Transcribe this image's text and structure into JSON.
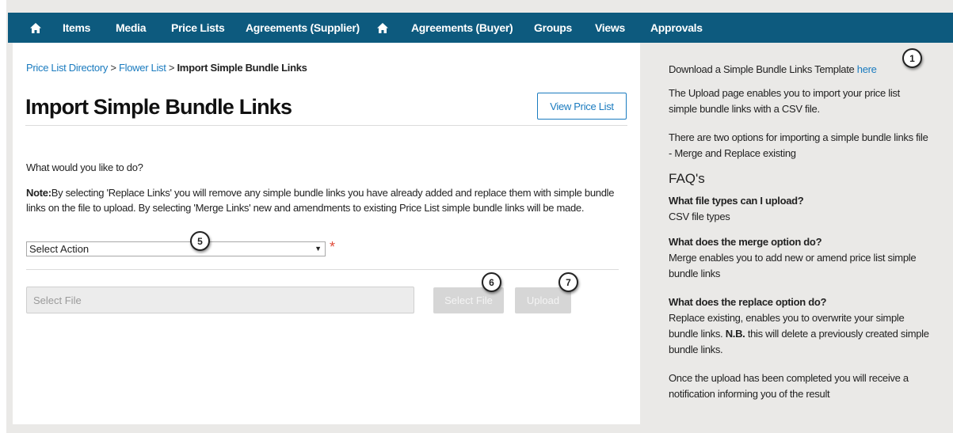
{
  "nav": {
    "items": [
      "Items",
      "Media",
      "Price Lists",
      "Agreements (Supplier)",
      "Agreements (Buyer)",
      "Groups",
      "Views",
      "Approvals"
    ],
    "home_icon": "home-icon"
  },
  "breadcrumb": {
    "items": [
      "Price List Directory",
      "Flower List"
    ],
    "separator": ">",
    "current": "Import Simple Bundle Links"
  },
  "page": {
    "title": "Import Simple Bundle Links",
    "view_button": "View Price List"
  },
  "form": {
    "question": "What would you like to do?",
    "note_label": "Note:",
    "note_text": "By selecting 'Replace Links' you will remove any simple bundle links you have already added and replace them with simple bundle links on the file to upload. By selecting 'Merge Links' new and amendments to existing Price List simple bundle links will be made.",
    "select_value": "Select Action",
    "required_mark": "*",
    "file_placeholder": "Select File",
    "select_file_button": "Select File",
    "upload_button": "Upload"
  },
  "side": {
    "download_text": "Download a Simple Bundle Links Template",
    "download_link": "here",
    "intro": "The Upload page enables you to import your price list simple bundle links with a CSV file.",
    "options": "There are two options for importing a simple bundle links file - Merge and Replace existing",
    "faq_heading": "FAQ's",
    "faq": [
      {
        "q": "What file types can I upload?",
        "a": "CSV file types"
      },
      {
        "q": "What does the merge option do?",
        "a": "Merge enables you to add new or amend price list simple bundle links"
      }
    ],
    "faq3_q": "What does the replace option do?",
    "faq3_a1": "Replace existing, enables you to overwrite your simple bundle links.",
    "faq3_nb": "N.B.",
    "faq3_a2": "this will delete a previously created simple bundle links.",
    "footer": "Once the upload has been completed you will receive a notification informing you of the result"
  },
  "callouts": [
    "1",
    "5",
    "6",
    "7"
  ],
  "colors": {
    "nav_bg": "#0d5a7e",
    "link": "#1a7bbf",
    "required": "#e04b3a",
    "side_bg": "#eae9e7"
  }
}
